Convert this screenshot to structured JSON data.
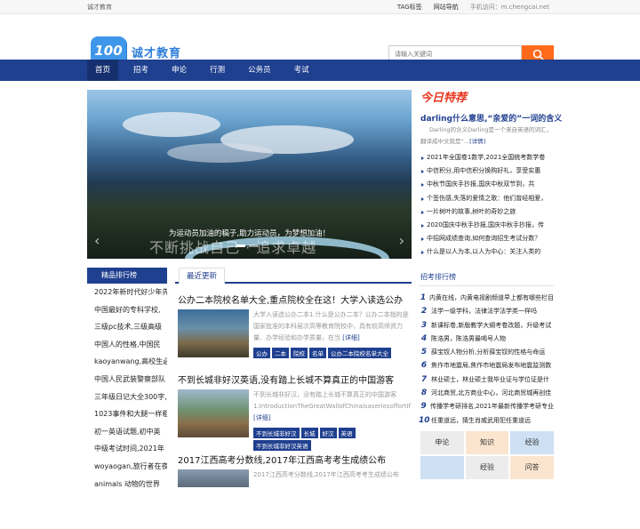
{
  "topbar": {
    "site_name": "诚才教育",
    "tag_label": "TAG标签",
    "nav_label": "网站导航",
    "mobile_label": "手机访问：m.chengcai.net"
  },
  "header": {
    "logo_text": "100",
    "brand": "诚才教育",
    "search_placeholder": "请输入关键词"
  },
  "nav": [
    {
      "label": "首页",
      "active": true
    },
    {
      "label": "招考"
    },
    {
      "label": "申论"
    },
    {
      "label": "行测"
    },
    {
      "label": "公务员"
    },
    {
      "label": "考试"
    }
  ],
  "slider": {
    "caption": "为运动员加油的稿子,助力运动员，为梦想加油！",
    "overlay_text": "不断挑战自己 · 追求卓越"
  },
  "rank": {
    "title": "精品排行榜",
    "items": [
      "2022年新时代好少年先",
      "中国最好的专科学校,",
      "三级pc技术,三级高级",
      "中国人的性格,中国民",
      "kaoyanwang,高校生必",
      "中国人民武装警察部队",
      "三年级日记大全300字,",
      "1023事件和大腿一样粗",
      "初一英语试题,初中英",
      "中级考试时间,2021年",
      "woyaogan,旅行者在夜",
      "animals 动物的世界"
    ]
  },
  "latest": {
    "tab_label": "最近更新",
    "articles": [
      {
        "title": "公办二本院校名单大全,重点院校全在这！大学入读选公办",
        "desc": "大学入读选公办二本1.什么是公办二本？公办二本指的是国家批准的本科层次高等教育院校中，具有较高师资力量、办学经验和办学质量，在当",
        "more": "[详细]",
        "tags": [
          "公办",
          "二本",
          "院校",
          "名单",
          "公办二本院校名单大全"
        ]
      },
      {
        "title": "不到长城非好汉英语,没有踏上长城不算真正的中国游客",
        "desc": "不到长城非好汉，没有踏上长城不算真正的中国游客1.IntroductionTheGreatWallofChinaisaseriesoffortificationsthi",
        "more": "[详细]",
        "tags": [
          "不到长城非好汉",
          "长城",
          "好汉",
          "英语",
          "不到长城非好汉英语"
        ]
      },
      {
        "title": "2017江西高考分数线,2017年江西高考考生成绩公布",
        "desc": "2017江西高考分数线,2017年江西高考考生成绩公布",
        "more": "",
        "tags": []
      }
    ]
  },
  "today": {
    "label": "今日特荐",
    "feature_title": "darling什么意思,“亲爱的”一词的含义",
    "feature_desc": "Darling的含义Darling是一个来自英语的词汇，翻译成中文就是“...",
    "feature_more": "[详情]",
    "list": [
      "2021年全国卷1数学,2021全国统考数学卷",
      "中信积分,用中信积分换购好礼，享受实惠",
      "中秋节国庆手抄报,国庆中秋双节到，共",
      "个签伤感,失落的爱情之歌：他们曾经相爱，",
      "一片树叶的故事,树叶的奇妙之旅",
      "2020国庆中秋手抄报,国庆中秋手抄报，传",
      "中招网成绩查询,如何查询招生考试分数？",
      "什么是以人为本,以人为中心：关注人类的"
    ]
  },
  "rank2": {
    "title": "招考排行榜",
    "items": [
      {
        "num": "1",
        "text": "内黄在线，内黄电视剧频道早上都有哪些栏目"
      },
      {
        "num": "2",
        "text": "法学一级学科，法律法学法学类一样吗"
      },
      {
        "num": "3",
        "text": "新课标卷,新版教学大纲考卷改题，升级考试"
      },
      {
        "num": "4",
        "text": "陈浩男，陈浩男最喝号人物"
      },
      {
        "num": "5",
        "text": "薛宝钗人物分析,分析薛宝钗的性格与命运"
      },
      {
        "num": "6",
        "text": "焦作市地震局,焦作市地震局发布地震监测数"
      },
      {
        "num": "7",
        "text": "林业硕士，林业硕士我毕业证与学位证是什"
      },
      {
        "num": "8",
        "text": "河北商贸,北方商业中心，河北商贸城再创佳"
      },
      {
        "num": "9",
        "text": "传播学考研排名,2021年最新传播学考研专业"
      },
      {
        "num": "10",
        "text": "任重道远，猜生肖威武用犯任重道远"
      }
    ]
  },
  "tagcloud": [
    "申论",
    "知识",
    "经验",
    "",
    "经验",
    "问答"
  ]
}
